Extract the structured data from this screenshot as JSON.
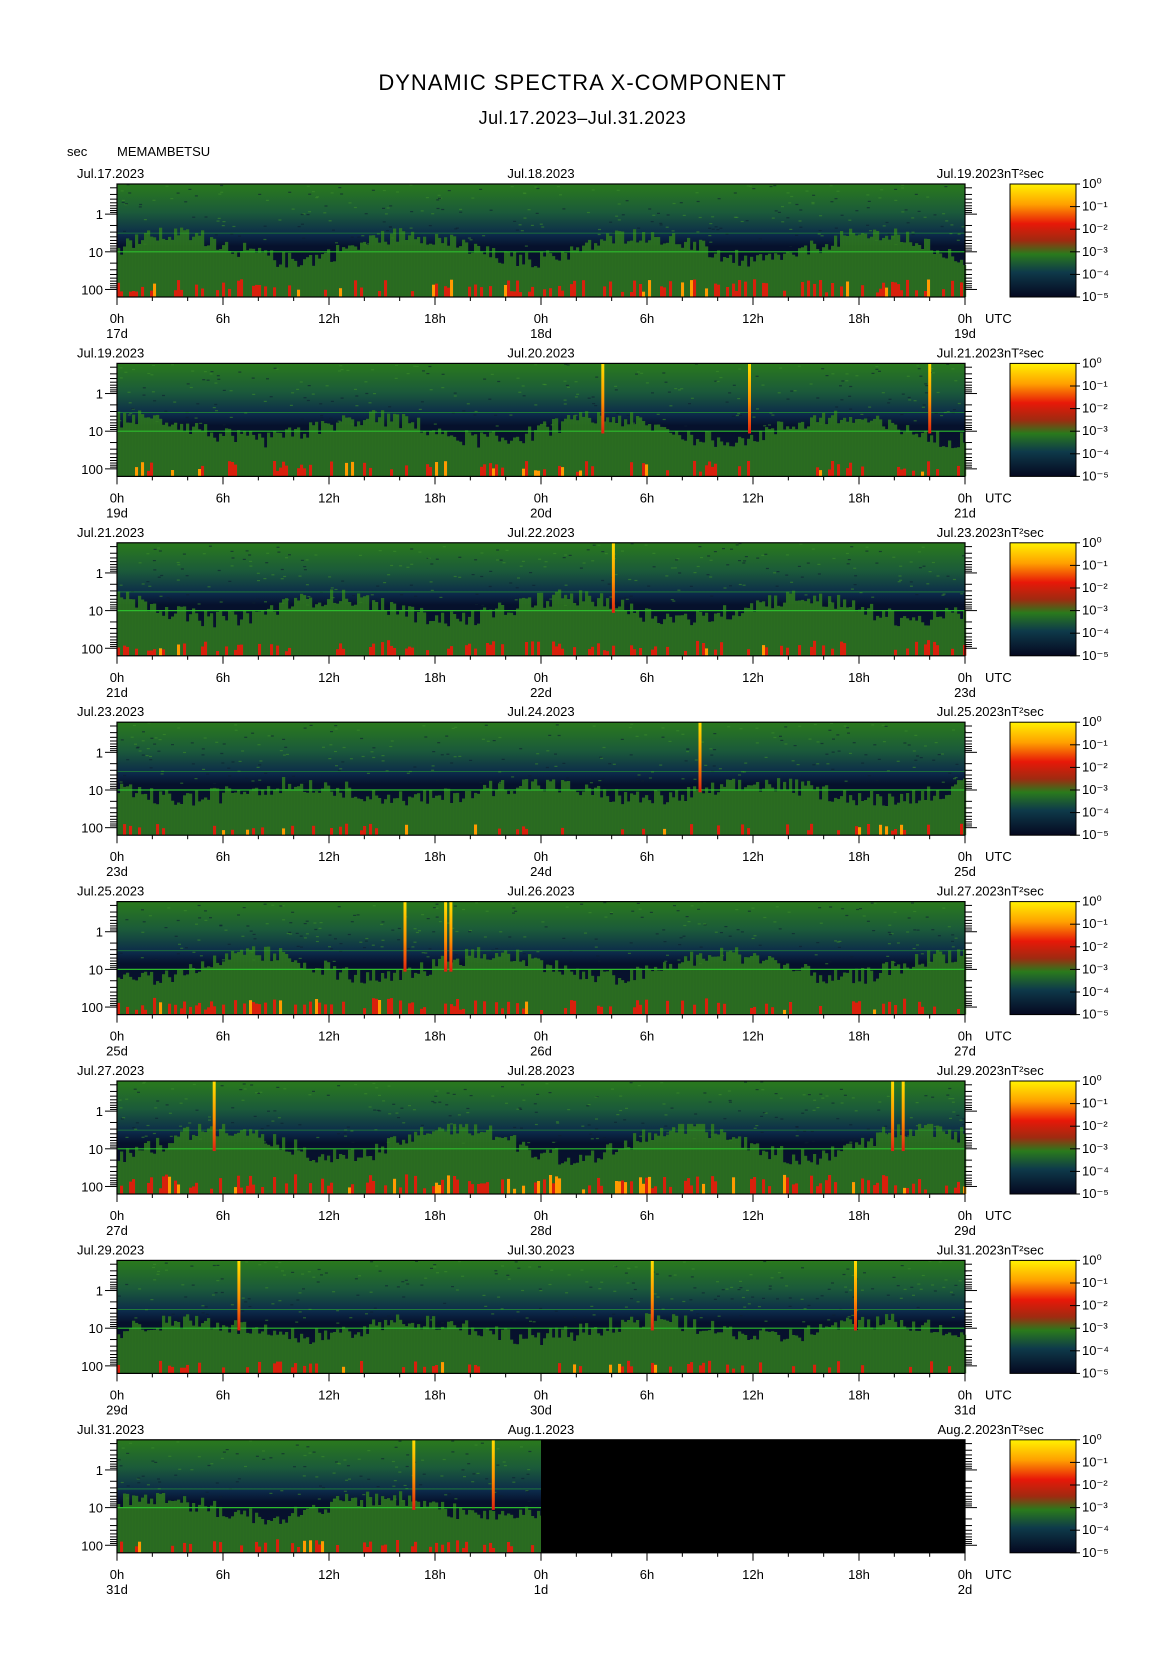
{
  "title": "DYNAMIC SPECTRA X-COMPONENT",
  "subtitle": "Jul.17.2023–Jul.31.2023",
  "y_unit_label": "sec",
  "station": "MEMAMBETSU",
  "colorbar": {
    "unit_label": "nT²sec",
    "ticks": [
      "10⁰",
      "10⁻¹",
      "10⁻²",
      "10⁻³",
      "10⁻⁴",
      "10⁻⁵"
    ]
  },
  "colors": {
    "low": "#0a0f3a",
    "mid": "#1f6e1f",
    "high": "#e0200a",
    "peak": "#ffe000",
    "line": "#2dbb2d"
  },
  "chart_data": [
    {
      "type": "heatmap",
      "date_left": "Jul.17.2023",
      "date_mid": "Jul.18.2023",
      "date_right": "Jul.19.2023",
      "day_start": "17d",
      "day_mid": "18d",
      "day_end": "19d",
      "x_ticks": [
        "0h",
        "6h",
        "12h",
        "18h",
        "0h",
        "6h",
        "12h",
        "18h",
        "0h"
      ],
      "x_unit": "UTC",
      "y_ticks": [
        "1",
        "10",
        "100"
      ],
      "ylabel": "sec",
      "y_scale": "log",
      "events": [],
      "activity": 0.65,
      "data_end": 1
    },
    {
      "type": "heatmap",
      "date_left": "Jul.19.2023",
      "date_mid": "Jul.20.2023",
      "date_right": "Jul.21.2023",
      "day_start": "19d",
      "day_mid": "20d",
      "day_end": "21d",
      "x_ticks": [
        "0h",
        "6h",
        "12h",
        "18h",
        "0h",
        "6h",
        "12h",
        "18h",
        "0h"
      ],
      "x_unit": "UTC",
      "y_ticks": [
        "1",
        "10",
        "100"
      ],
      "ylabel": "sec",
      "y_scale": "log",
      "events": [
        27.5,
        35.8,
        46.0
      ],
      "activity": 0.55,
      "data_end": 1
    },
    {
      "type": "heatmap",
      "date_left": "Jul.21.2023",
      "date_mid": "Jul.22.2023",
      "date_right": "Jul.23.2023",
      "day_start": "21d",
      "day_mid": "22d",
      "day_end": "23d",
      "x_ticks": [
        "0h",
        "6h",
        "12h",
        "18h",
        "0h",
        "6h",
        "12h",
        "18h",
        "0h"
      ],
      "x_unit": "UTC",
      "y_ticks": [
        "1",
        "10",
        "100"
      ],
      "ylabel": "sec",
      "y_scale": "log",
      "events": [
        28.1
      ],
      "activity": 0.55,
      "data_end": 1
    },
    {
      "type": "heatmap",
      "date_left": "Jul.23.2023",
      "date_mid": "Jul.24.2023",
      "date_right": "Jul.25.2023",
      "day_start": "23d",
      "day_mid": "24d",
      "day_end": "25d",
      "x_ticks": [
        "0h",
        "6h",
        "12h",
        "18h",
        "0h",
        "6h",
        "12h",
        "18h",
        "0h"
      ],
      "x_unit": "UTC",
      "y_ticks": [
        "1",
        "10",
        "100"
      ],
      "ylabel": "sec",
      "y_scale": "log",
      "events": [
        33.0
      ],
      "activity": 0.35,
      "data_end": 1
    },
    {
      "type": "heatmap",
      "date_left": "Jul.25.2023",
      "date_mid": "Jul.26.2023",
      "date_right": "Jul.27.2023",
      "day_start": "25d",
      "day_mid": "26d",
      "day_end": "27d",
      "x_ticks": [
        "0h",
        "6h",
        "12h",
        "18h",
        "0h",
        "6h",
        "12h",
        "18h",
        "0h"
      ],
      "x_unit": "UTC",
      "y_ticks": [
        "1",
        "10",
        "100"
      ],
      "ylabel": "sec",
      "y_scale": "log",
      "events": [
        16.3,
        18.6,
        18.9
      ],
      "activity": 0.6,
      "data_end": 1
    },
    {
      "type": "heatmap",
      "date_left": "Jul.27.2023",
      "date_mid": "Jul.28.2023",
      "date_right": "Jul.29.2023",
      "day_start": "27d",
      "day_mid": "28d",
      "day_end": "29d",
      "x_ticks": [
        "0h",
        "6h",
        "12h",
        "18h",
        "0h",
        "6h",
        "12h",
        "18h",
        "0h"
      ],
      "x_unit": "UTC",
      "y_ticks": [
        "1",
        "10",
        "100"
      ],
      "ylabel": "sec",
      "y_scale": "log",
      "events": [
        5.5,
        43.9,
        44.5
      ],
      "activity": 0.75,
      "data_end": 1
    },
    {
      "type": "heatmap",
      "date_left": "Jul.29.2023",
      "date_mid": "Jul.30.2023",
      "date_right": "Jul.31.2023",
      "day_start": "29d",
      "day_mid": "30d",
      "day_end": "31d",
      "x_ticks": [
        "0h",
        "6h",
        "12h",
        "18h",
        "0h",
        "6h",
        "12h",
        "18h",
        "0h"
      ],
      "x_unit": "UTC",
      "y_ticks": [
        "1",
        "10",
        "100"
      ],
      "ylabel": "sec",
      "y_scale": "log",
      "events": [
        6.9,
        30.3,
        41.8
      ],
      "activity": 0.4,
      "data_end": 1
    },
    {
      "type": "heatmap",
      "date_left": "Jul.31.2023",
      "date_mid": "Aug.1.2023",
      "date_right": "Aug.2.2023",
      "day_start": "31d",
      "day_mid": "1d",
      "day_end": "2d",
      "x_ticks": [
        "0h",
        "6h",
        "12h",
        "18h",
        "0h",
        "6h",
        "12h",
        "18h",
        "0h"
      ],
      "x_unit": "UTC",
      "y_ticks": [
        "1",
        "10",
        "100"
      ],
      "ylabel": "sec",
      "y_scale": "log",
      "events": [
        16.8,
        21.3
      ],
      "activity": 0.45,
      "data_end": 0.5
    }
  ]
}
